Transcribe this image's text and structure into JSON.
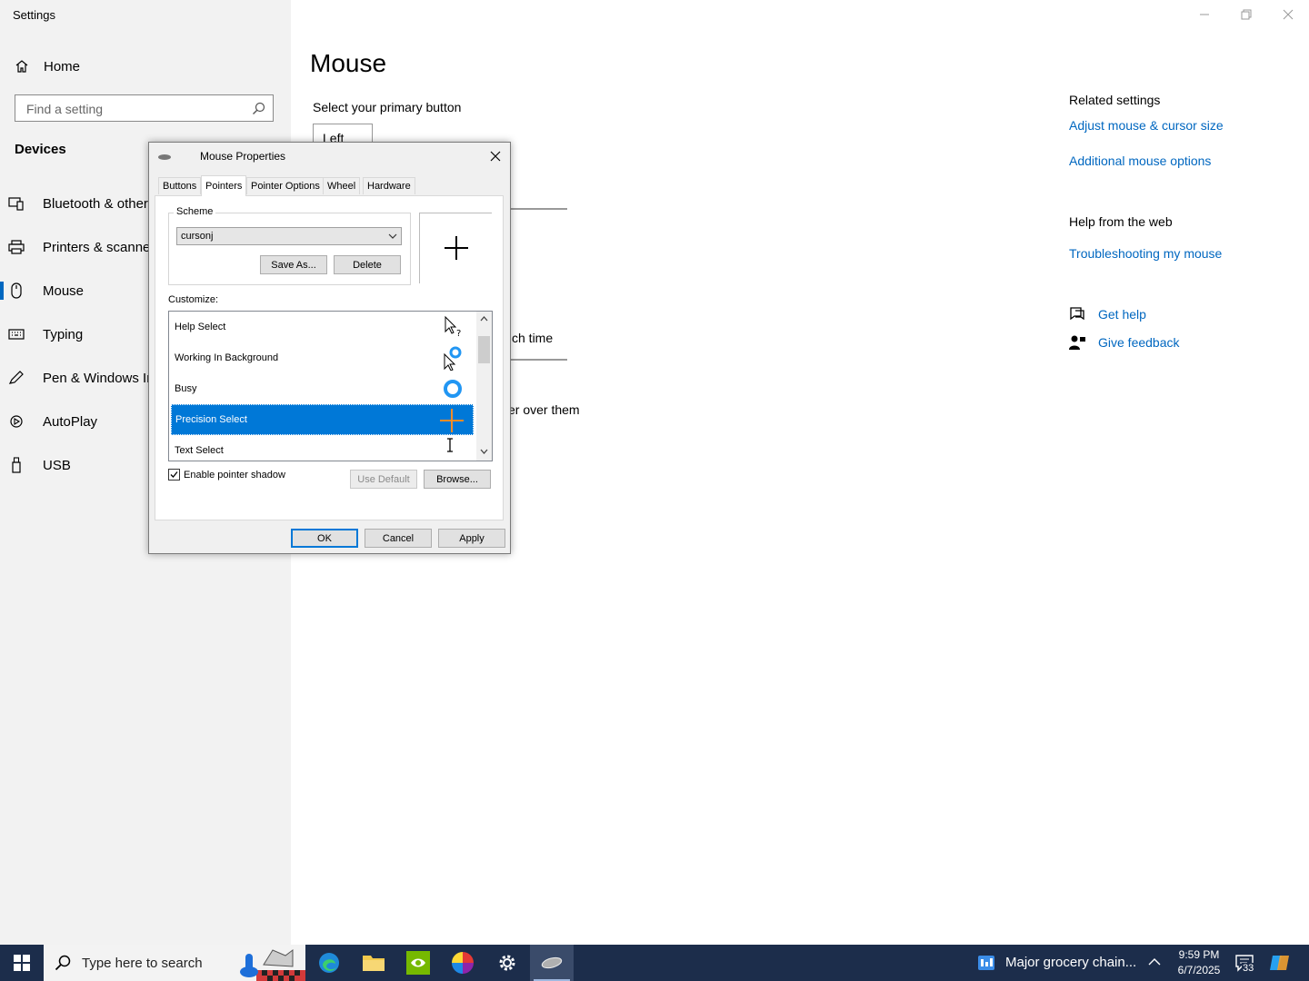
{
  "app": {
    "title": "Settings"
  },
  "sidebar": {
    "home_label": "Home",
    "search_placeholder": "Find a setting",
    "section_title": "Devices",
    "items": [
      {
        "label": "Bluetooth & other d",
        "icon": "bluetooth-devices-icon"
      },
      {
        "label": "Printers & scanners",
        "icon": "printer-icon"
      },
      {
        "label": "Mouse",
        "icon": "mouse-icon",
        "active": true
      },
      {
        "label": "Typing",
        "icon": "keyboard-icon"
      },
      {
        "label": "Pen & Windows Ink",
        "icon": "pen-icon"
      },
      {
        "label": "AutoPlay",
        "icon": "autoplay-icon"
      },
      {
        "label": "USB",
        "icon": "usb-icon"
      }
    ]
  },
  "main": {
    "title": "Mouse",
    "primary_button_label": "Select your primary button",
    "primary_button_value": "Left",
    "scroll_time_fragment": "ch time",
    "hover_fragment": "er over them"
  },
  "related": {
    "title": "Related settings",
    "link1": "Adjust mouse & cursor size",
    "link2": "Additional mouse options",
    "help_title": "Help from the web",
    "help_link": "Troubleshooting my mouse",
    "get_help": "Get help",
    "feedback": "Give feedback"
  },
  "dialog": {
    "title": "Mouse Properties",
    "tabs": [
      "Buttons",
      "Pointers",
      "Pointer Options",
      "Wheel",
      "Hardware"
    ],
    "selected_tab": "Pointers",
    "scheme_label": "Scheme",
    "scheme_value": "cursonj",
    "save_as": "Save As...",
    "delete": "Delete",
    "customize_label": "Customize:",
    "cursors": [
      {
        "label": "Help Select",
        "icon": "help-select-cursor-icon"
      },
      {
        "label": "Working In Background",
        "icon": "working-background-cursor-icon"
      },
      {
        "label": "Busy",
        "icon": "busy-cursor-icon"
      },
      {
        "label": "Precision Select",
        "icon": "precision-select-cursor-icon",
        "selected": true
      },
      {
        "label": "Text Select",
        "icon": "text-select-cursor-icon"
      }
    ],
    "shadow_label": "Enable pointer shadow",
    "shadow_checked": true,
    "use_default": "Use Default",
    "browse": "Browse...",
    "ok": "OK",
    "cancel": "Cancel",
    "apply": "Apply"
  },
  "taskbar": {
    "search_placeholder": "Type here to search",
    "news": "Major grocery chain...",
    "time": "9:59 PM",
    "date": "6/7/2025",
    "notification_count": "33"
  },
  "colors": {
    "accent": "#0067c0",
    "selection": "#0078d7",
    "taskbar": "#1c2d4b"
  }
}
